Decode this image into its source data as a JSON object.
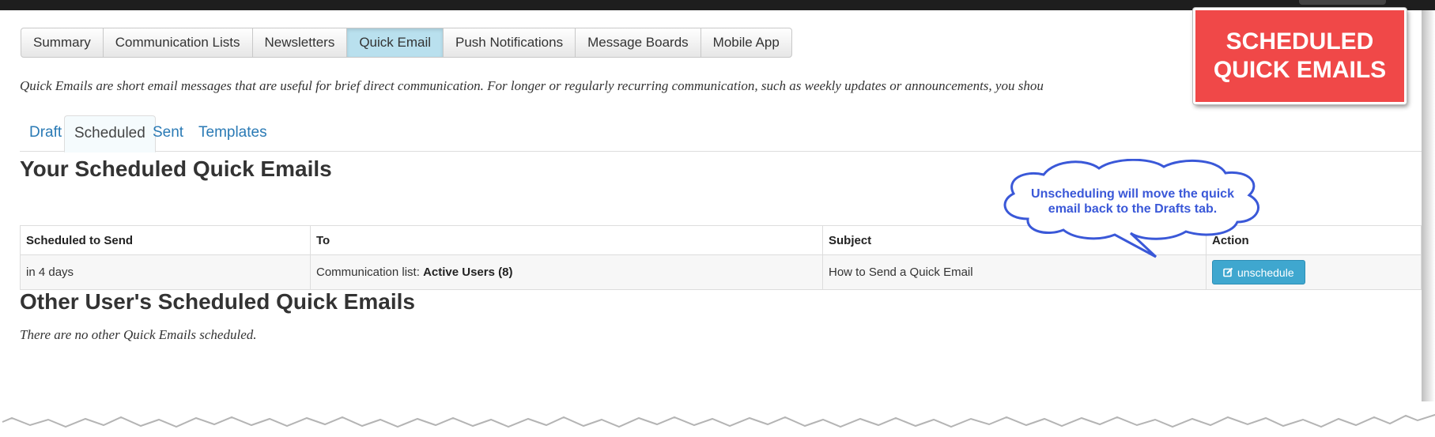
{
  "nav": {
    "items": [
      "Summary",
      "Communication Lists",
      "Newsletters",
      "Quick Email",
      "Push Notifications",
      "Message Boards",
      "Mobile App"
    ],
    "active": "Quick Email"
  },
  "intro_text": "Quick Emails are short email messages that are useful for brief direct communication. For longer or regularly recurring communication, such as weekly updates or announcements, you shou",
  "subtabs": {
    "items": [
      "Draft",
      "Scheduled",
      "Sent",
      "Templates"
    ],
    "active": "Scheduled"
  },
  "scheduled": {
    "heading": "Your Scheduled Quick Emails",
    "columns": [
      "Scheduled to Send",
      "To",
      "Subject",
      "Action"
    ],
    "rows": [
      {
        "when": "in 4 days",
        "to_prefix": "Communication list:",
        "to_list": "Active Users (8)",
        "subject": "How to Send a Quick Email",
        "action_label": "unschedule"
      }
    ]
  },
  "others": {
    "heading": "Other User's Scheduled Quick Emails",
    "empty_text": "There are no other Quick Emails scheduled."
  },
  "callout": {
    "line1": "Unscheduling will move the quick",
    "line2": "email back to the Drafts tab."
  },
  "banner": {
    "line1": "SCHEDULED",
    "line2": "QUICK EMAILS"
  },
  "colors": {
    "banner_bg": "#f04848",
    "callout_text": "#3a58d8",
    "link": "#2a7ab5",
    "button": "#3fa7cf",
    "active_nav": "#b9e0ee"
  },
  "icons": {
    "unschedule": "edit-square-icon"
  }
}
